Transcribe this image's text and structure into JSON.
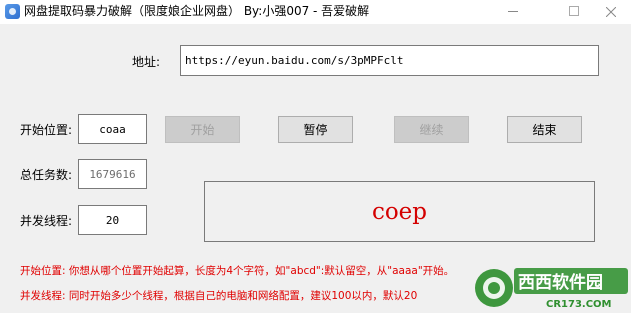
{
  "window": {
    "title": "网盘提取码暴力破解（限度娘企业网盘） By:小强007 - 吾爱破解"
  },
  "form": {
    "address_label": "地址:",
    "address_value": "https://eyun.baidu.com/s/3pMPFclt",
    "start_pos_label": "开始位置:",
    "start_pos_value": "coaa",
    "total_tasks_label": "总任务数:",
    "total_tasks_value": "1679616",
    "threads_label": "并发线程:",
    "threads_value": "20"
  },
  "buttons": {
    "start": "开始",
    "pause": "暂停",
    "resume": "继续",
    "end": "结束"
  },
  "current_code": "coep",
  "help": {
    "line1": "开始位置: 你想从哪个位置开始起算，长度为4个字符，如\"abcd\":默认留空，从\"aaaa\"开始。",
    "line2": "并发线程: 同时开始多少个线程，根据自己的电脑和网络配置，建议100以内，默认20"
  },
  "watermark": {
    "brand": "西西软件园",
    "domain": "CR173.COM"
  },
  "colors": {
    "help_text": "#e00000",
    "code_text": "#d40000"
  }
}
